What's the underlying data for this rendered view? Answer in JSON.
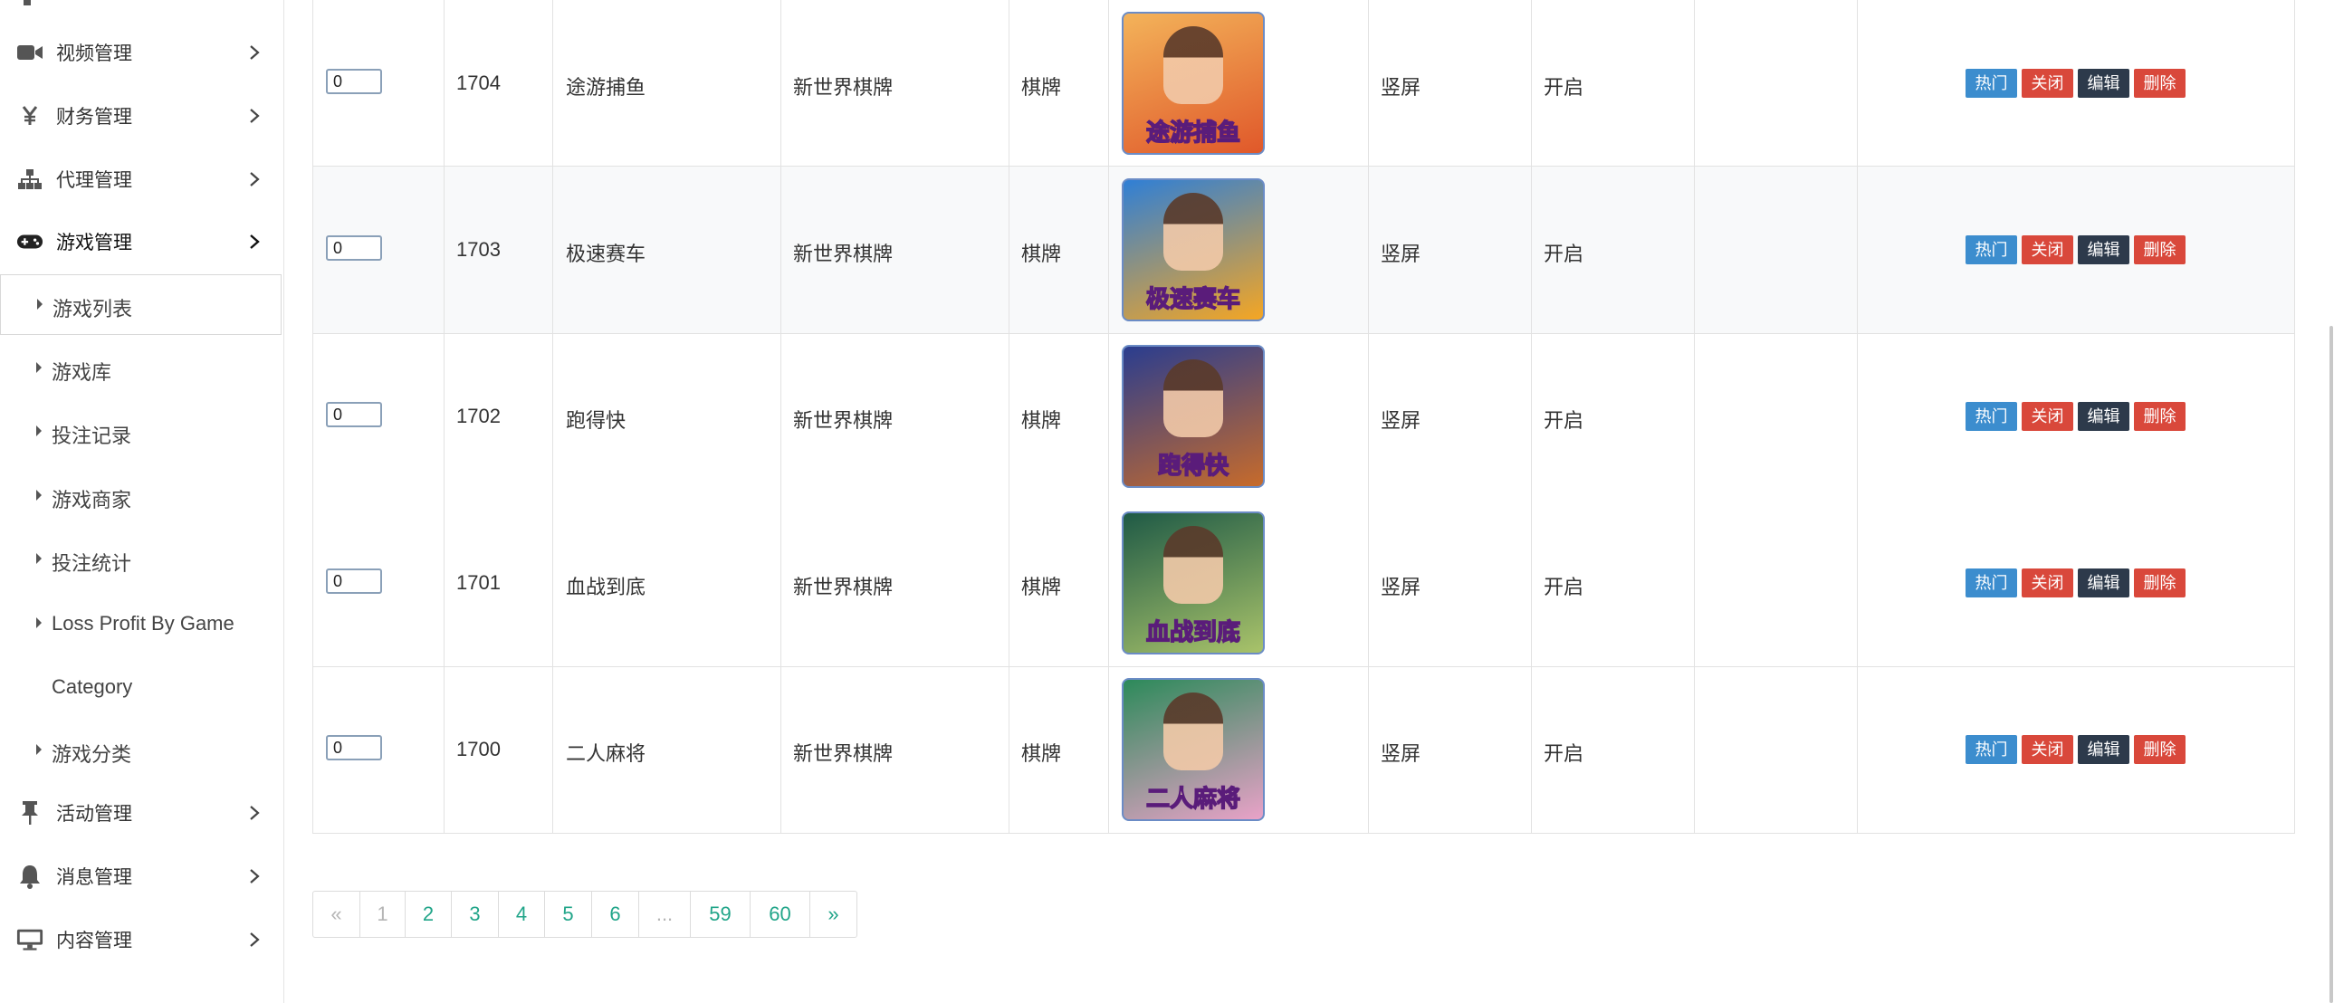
{
  "sidebar": {
    "items": [
      {
        "label": "视频管理",
        "icon": "video-camera-icon"
      },
      {
        "label": "财务管理",
        "icon": "yen-icon"
      },
      {
        "label": "代理管理",
        "icon": "sitemap-icon"
      },
      {
        "label": "游戏管理",
        "icon": "gamepad-icon"
      },
      {
        "label": "活动管理",
        "icon": "thumbtack-icon"
      },
      {
        "label": "消息管理",
        "icon": "bell-icon"
      },
      {
        "label": "内容管理",
        "icon": "desktop-icon"
      }
    ],
    "game_submenu": [
      {
        "label": "游戏列表"
      },
      {
        "label": "游戏库"
      },
      {
        "label": "投注记录"
      },
      {
        "label": "游戏商家"
      },
      {
        "label": "投注统计"
      },
      {
        "label": "Loss Profit By Game",
        "label2": "Category"
      },
      {
        "label": "游戏分类"
      }
    ]
  },
  "table": {
    "rows": [
      {
        "sort": "0",
        "id": "1704",
        "name": "途游捕鱼",
        "vendor": "新世界棋牌",
        "type": "棋牌",
        "thumb_text": "途游捕鱼",
        "orientation": "竖屏",
        "status": "开启"
      },
      {
        "sort": "0",
        "id": "1703",
        "name": "极速赛车",
        "vendor": "新世界棋牌",
        "type": "棋牌",
        "thumb_text": "极速赛车",
        "orientation": "竖屏",
        "status": "开启"
      },
      {
        "sort": "0",
        "id": "1702",
        "name": "跑得快",
        "vendor": "新世界棋牌",
        "type": "棋牌",
        "thumb_text": "跑得快",
        "orientation": "竖屏",
        "status": "开启"
      },
      {
        "sort": "0",
        "id": "1701",
        "name": "血战到底",
        "vendor": "新世界棋牌",
        "type": "棋牌",
        "thumb_text": "血战到底",
        "orientation": "竖屏",
        "status": "开启"
      },
      {
        "sort": "0",
        "id": "1700",
        "name": "二人麻将",
        "vendor": "新世界棋牌",
        "type": "棋牌",
        "thumb_text": "二人麻将",
        "orientation": "竖屏",
        "status": "开启"
      }
    ],
    "actions": {
      "hot": "热门",
      "close": "关闭",
      "edit": "编辑",
      "delete": "删除"
    }
  },
  "pagination": {
    "prev": "«",
    "pages": [
      "1",
      "2",
      "3",
      "4",
      "5",
      "6",
      "...",
      "59",
      "60"
    ],
    "current": "1",
    "next": "»"
  },
  "colors": {
    "hot": "#3c8dce",
    "danger": "#d9483b",
    "edit": "#2d3a4b",
    "link": "#21a589"
  }
}
